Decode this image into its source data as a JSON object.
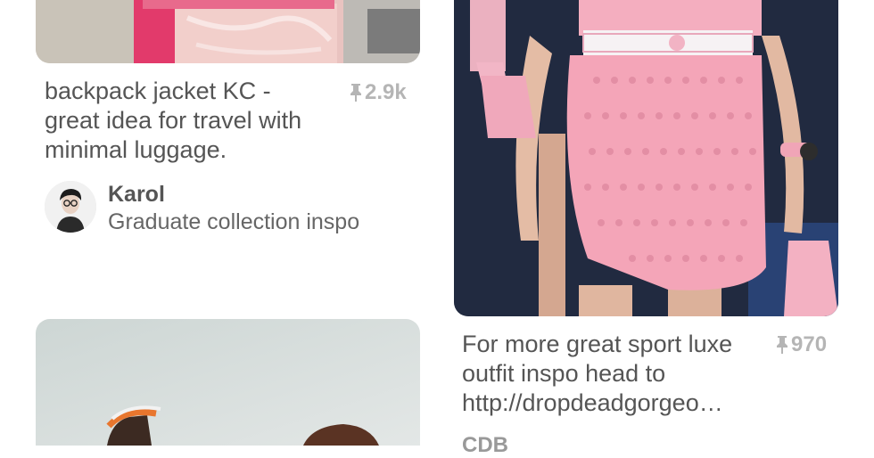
{
  "pins": [
    {
      "description": "backpack jacket KC -\ngreat idea for travel with\nminimal luggage.",
      "repin_count": "2.9k",
      "pinner_name": "Karol",
      "board_name": "Graduate collection inspo"
    },
    {
      "description": "For more great sport luxe\noutfit inspo head to\nhttp://dropdeadgorgeo…",
      "repin_count": "970",
      "pinner_name": "CDB"
    },
    {
      "description": ""
    }
  ],
  "icons": {
    "repin": "pushpin-icon",
    "avatar": "user-avatar"
  },
  "colors": {
    "pink": "#f0a0b4",
    "text": "#555555",
    "muted": "#b5b5b5"
  }
}
